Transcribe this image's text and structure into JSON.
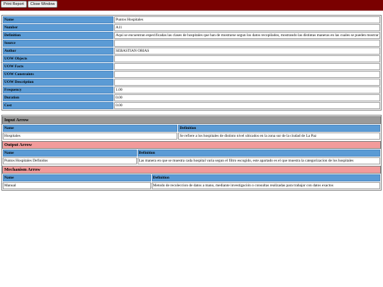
{
  "toolbar": {
    "print_label": "Print Report",
    "close_label": "Close Window"
  },
  "details": [
    {
      "label": "Name",
      "value": "Puntos Hospitales"
    },
    {
      "label": "Number",
      "value": "A11"
    },
    {
      "label": "Definition",
      "value": "Aqui se encuentran especificadas las clases de hospitales que han de mostrarse segun los datos recopilados, mostrando las distintas maneras en las cuales se pueden mostrar"
    },
    {
      "label": "Source",
      "value": ""
    },
    {
      "label": "Author",
      "value": "SEBASTIAN ORIAS"
    },
    {
      "label": "UOW Objects",
      "value": ""
    },
    {
      "label": "UOW Facts",
      "value": ""
    },
    {
      "label": "UOW Constraints",
      "value": ""
    },
    {
      "label": "UOW Description",
      "value": ""
    },
    {
      "label": "Frequency",
      "value": "1.00"
    },
    {
      "label": "Duration",
      "value": "0.00"
    },
    {
      "label": "Cost",
      "value": "0.00"
    }
  ],
  "input_arrow": {
    "title": "Input Arrow",
    "col_name": "Name",
    "col_definition": "Definition",
    "rows": [
      {
        "name": "Hospitales",
        "definition": "Se refiere a los hospitales de distinto nivel ubicados en la zona sur de la ciudad de La Paz"
      }
    ]
  },
  "output_arrow": {
    "title": "Output Arrow",
    "col_name": "Name",
    "col_definition": "Definition",
    "rows": [
      {
        "name": "Puntos Hospitales Definidos",
        "definition": "Las manera en que se muestra cada hospital varia segun el filtro escogido, este apartado es el que muestra la categorizacion de los hospitales"
      }
    ]
  },
  "mechanism_arrow": {
    "title": "Mechanism Arrow",
    "col_name": "Name",
    "col_definition": "Definition",
    "rows": [
      {
        "name": "Manual",
        "definition": "Metodo de recoleccion de datos a mano, mediante investigación o consultas realizadas para trabajar con datos exactos"
      }
    ]
  }
}
